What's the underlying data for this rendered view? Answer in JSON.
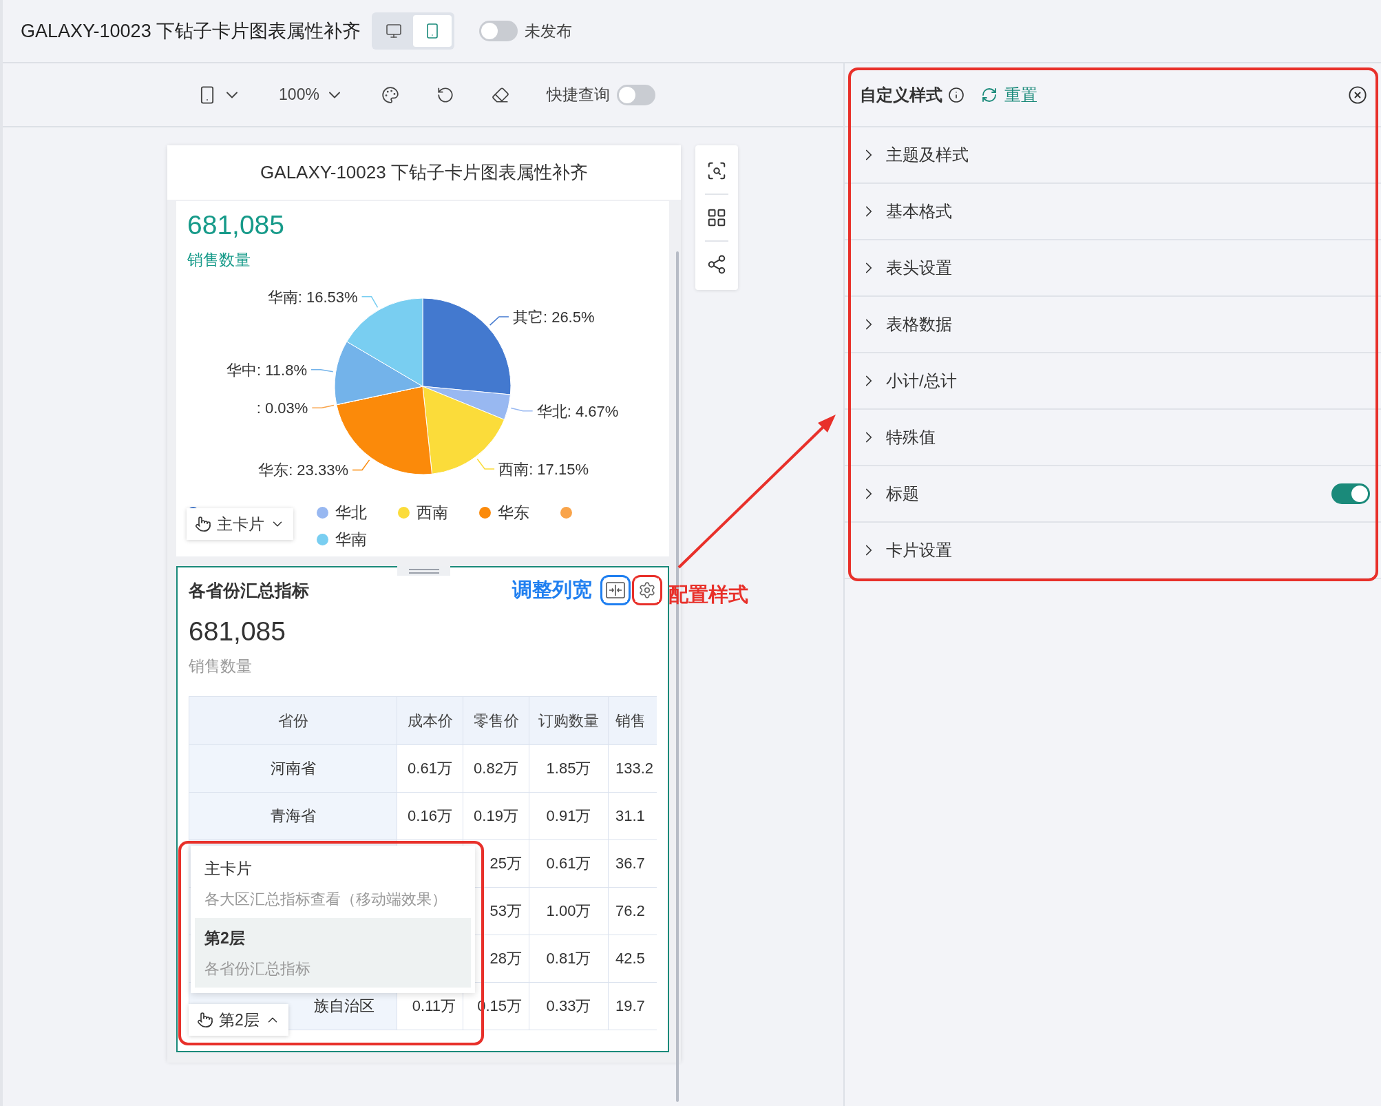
{
  "header": {
    "title": "GALAXY-10023 下钻子卡片图表属性补齐",
    "view_modes": [
      {
        "kind": "desktop",
        "selected": false
      },
      {
        "kind": "mobile",
        "selected": true
      }
    ],
    "publish": {
      "label": "未发布",
      "on": false
    }
  },
  "toolbar": {
    "zoom": "100%",
    "quick_query": {
      "label": "快捷查询",
      "on": false
    }
  },
  "canvas": {
    "title": "GALAXY-10023 下钻子卡片图表属性补齐",
    "pie_card": {
      "value": "681,085",
      "metric": "销售数量",
      "chart_data": {
        "type": "pie",
        "values": [
          26.5,
          4.67,
          17.15,
          23.33,
          0.03,
          11.8,
          16.53
        ],
        "colors": [
          "#4379cf",
          "#98b8f1",
          "#fbdc3a",
          "#fb8a0a",
          "#f9a44a",
          "#73b3ea",
          "#79cef1"
        ],
        "value_labels": [
          "其它: 26.5%",
          "华北: 4.67%",
          "西南: 17.15%",
          "华东: 23.33%",
          ": 0.03%",
          "华中: 11.8%",
          "华南: 16.53%"
        ]
      },
      "legend": [
        {
          "color": "#4379cf"
        },
        {
          "label": "华北",
          "color": "#98b8f1"
        },
        {
          "label": "西南",
          "color": "#fbdc3a"
        },
        {
          "label": "华东",
          "color": "#fb8a0a"
        },
        {
          "color": "#f9a44a"
        },
        {
          "label": "华南",
          "color": "#79cef1"
        }
      ],
      "layer_button": {
        "label": "主卡片",
        "expanded": false
      }
    },
    "table_card": {
      "title": "各省份汇总指标",
      "column_width_hint": "调整列宽",
      "style_hint": "配置样式",
      "value": "681,085",
      "metric": "销售数量",
      "columns": [
        "省份",
        "成本价",
        "零售价",
        "订购数量",
        "销售"
      ],
      "rows": [
        {
          "kind": "plain",
          "cells": [
            "河南省",
            "0.61万",
            "0.82万",
            "1.85万",
            "133.2"
          ]
        },
        {
          "kind": "plain",
          "cells": [
            "青海省",
            "0.16万",
            "0.19万",
            "0.91万",
            "31.1"
          ]
        },
        {
          "kind": "covered",
          "cells": [
            null,
            null,
            "25万",
            "0.61万",
            "36.7"
          ]
        },
        {
          "kind": "covered",
          "cells": [
            null,
            null,
            "53万",
            "1.00万",
            "76.2"
          ]
        },
        {
          "kind": "covered",
          "cells": [
            null,
            null,
            "28万",
            "0.81万",
            "42.5"
          ]
        },
        {
          "kind": "covered",
          "cells": [
            "族自治区",
            "0.11万",
            "0.15万",
            "0.33万",
            "19.7"
          ]
        }
      ],
      "layer_menu": [
        {
          "title": "主卡片",
          "subtitle": "各大区汇总指标查看（移动端效果）",
          "selected": false
        },
        {
          "title": "第2层",
          "subtitle": "各省份汇总指标",
          "selected": true
        }
      ],
      "layer_button": {
        "label": "第2层",
        "expanded": true
      }
    }
  },
  "style_panel": {
    "title": "自定义样式",
    "reset": "重置",
    "sections": [
      {
        "kind": "plain",
        "label": "主题及样式"
      },
      {
        "kind": "plain",
        "label": "基本格式"
      },
      {
        "kind": "plain",
        "label": "表头设置"
      },
      {
        "kind": "plain",
        "label": "表格数据"
      },
      {
        "kind": "plain",
        "label": "小计/总计"
      },
      {
        "kind": "plain",
        "label": "特殊值"
      },
      {
        "kind": "toggle",
        "label": "标题",
        "on": true
      },
      {
        "kind": "plain",
        "label": "卡片设置"
      }
    ]
  }
}
